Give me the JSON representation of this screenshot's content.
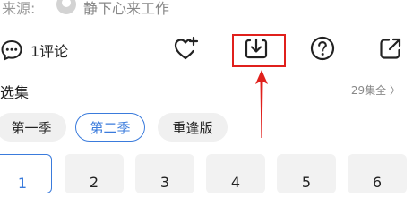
{
  "source": {
    "label": "来源:",
    "name": "静下心来工作"
  },
  "toolbar": {
    "comment_label": "1评论"
  },
  "episodes": {
    "title": "选集",
    "count_label": "29集全 〉",
    "seasons": [
      {
        "label": "第一季",
        "selected": false
      },
      {
        "label": "第二季",
        "selected": true
      },
      {
        "label": "重逢版",
        "selected": false
      }
    ],
    "items": [
      "1",
      "2",
      "3",
      "4",
      "5",
      "6"
    ]
  },
  "annotation": {
    "highlight_color": "#e0201c"
  },
  "colors": {
    "accent": "#3a7bdc",
    "muted": "#888888"
  }
}
